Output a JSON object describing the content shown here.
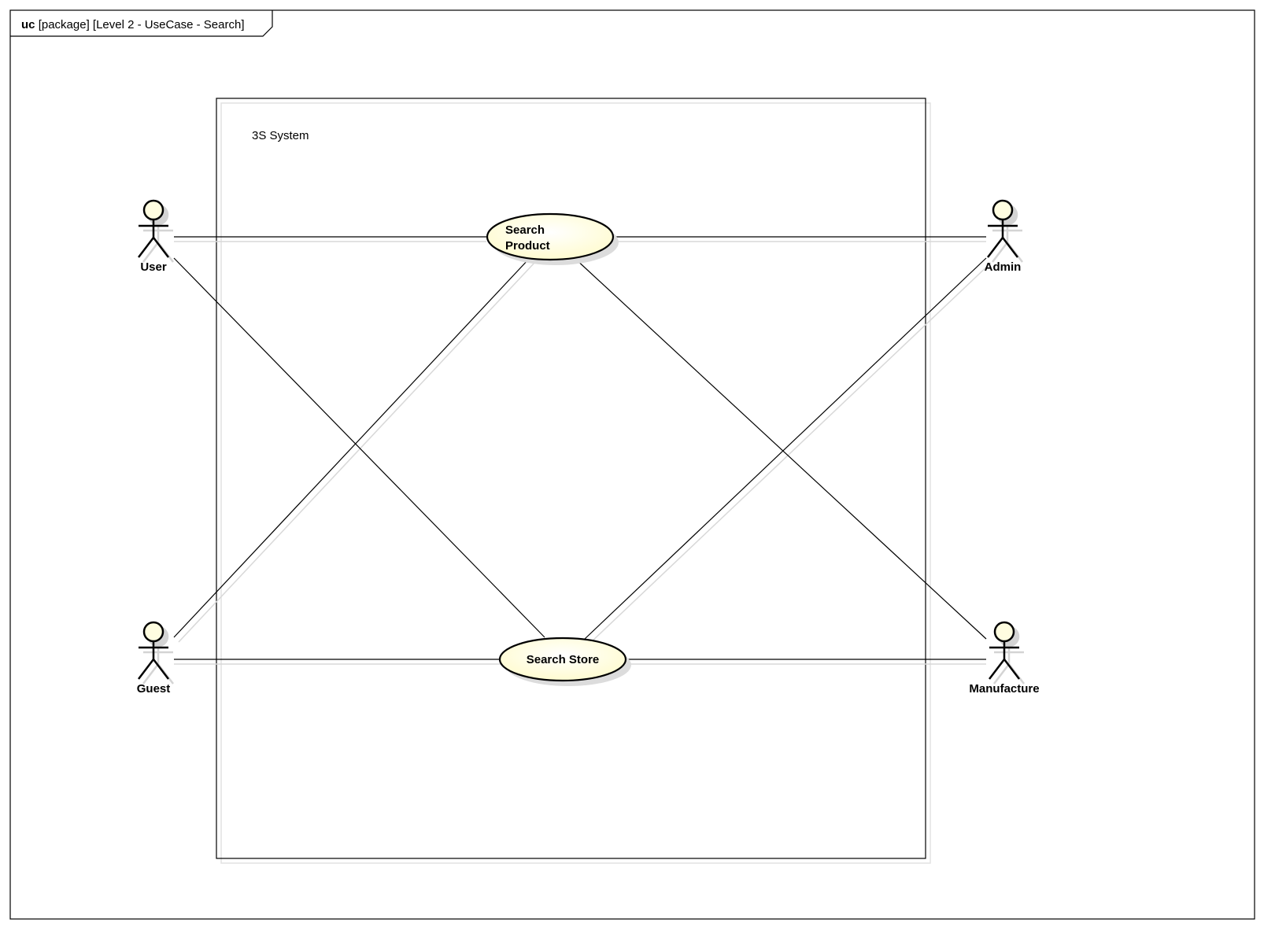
{
  "frame": {
    "keyword": "uc",
    "title": "[package] [Level 2 - UseCase - Search]"
  },
  "system": {
    "name": "3S System"
  },
  "actors": [
    {
      "id": "user",
      "name": "User"
    },
    {
      "id": "admin",
      "name": "Admin"
    },
    {
      "id": "guest",
      "name": "Guest"
    },
    {
      "id": "manufacture",
      "name": "Manufacture"
    }
  ],
  "use_cases": [
    {
      "id": "search-product",
      "lines": [
        "Search",
        "Product"
      ]
    },
    {
      "id": "search-store",
      "lines": [
        "Search Store"
      ]
    }
  ],
  "associations": [
    {
      "from": "User",
      "to": "Search Product"
    },
    {
      "from": "User",
      "to": "Search Store"
    },
    {
      "from": "Guest",
      "to": "Search Product"
    },
    {
      "from": "Guest",
      "to": "Search Store"
    },
    {
      "from": "Admin",
      "to": "Search Product"
    },
    {
      "from": "Admin",
      "to": "Search Store"
    },
    {
      "from": "Manufacture",
      "to": "Search Product"
    },
    {
      "from": "Manufacture",
      "to": "Search Store"
    }
  ],
  "colors": {
    "actor_head_fill": "#fffde0",
    "usecase_fill": "#ffffd8",
    "shadow": "#d8d8d8",
    "line": "#000000"
  }
}
